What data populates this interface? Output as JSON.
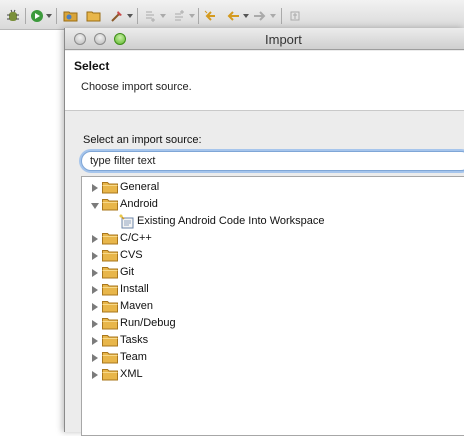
{
  "dialog": {
    "title": "Import",
    "header_title": "Select",
    "header_description": "Choose import source.",
    "source_label": "Select an import source:",
    "filter_value": "type filter text"
  },
  "toolbar": {
    "icons": [
      "debug-icon",
      "run-icon",
      "open-folder-icon",
      "new-folder-icon",
      "external-tools-icon",
      "next-annotation-icon",
      "previous-annotation-icon",
      "last-edit-icon",
      "back-icon",
      "forward-icon",
      "pin-icon"
    ]
  },
  "tree": {
    "items": [
      {
        "label": "General",
        "expanded": false,
        "icon": "folder-icon"
      },
      {
        "label": "Android",
        "expanded": true,
        "icon": "folder-icon",
        "children": [
          {
            "label": "Existing Android Code Into Workspace",
            "icon": "import-wizard-icon"
          }
        ]
      },
      {
        "label": "C/C++",
        "expanded": false,
        "icon": "folder-icon"
      },
      {
        "label": "CVS",
        "expanded": false,
        "icon": "folder-icon"
      },
      {
        "label": "Git",
        "expanded": false,
        "icon": "folder-icon"
      },
      {
        "label": "Install",
        "expanded": false,
        "icon": "folder-icon"
      },
      {
        "label": "Maven",
        "expanded": false,
        "icon": "folder-icon"
      },
      {
        "label": "Run/Debug",
        "expanded": false,
        "icon": "folder-icon"
      },
      {
        "label": "Tasks",
        "expanded": false,
        "icon": "folder-icon"
      },
      {
        "label": "Team",
        "expanded": false,
        "icon": "folder-icon"
      },
      {
        "label": "XML",
        "expanded": false,
        "icon": "folder-icon"
      }
    ]
  },
  "colors": {
    "folder": "#e8b64a",
    "filter_focus": "#a6c5ec",
    "window_bg": "#ececec"
  }
}
